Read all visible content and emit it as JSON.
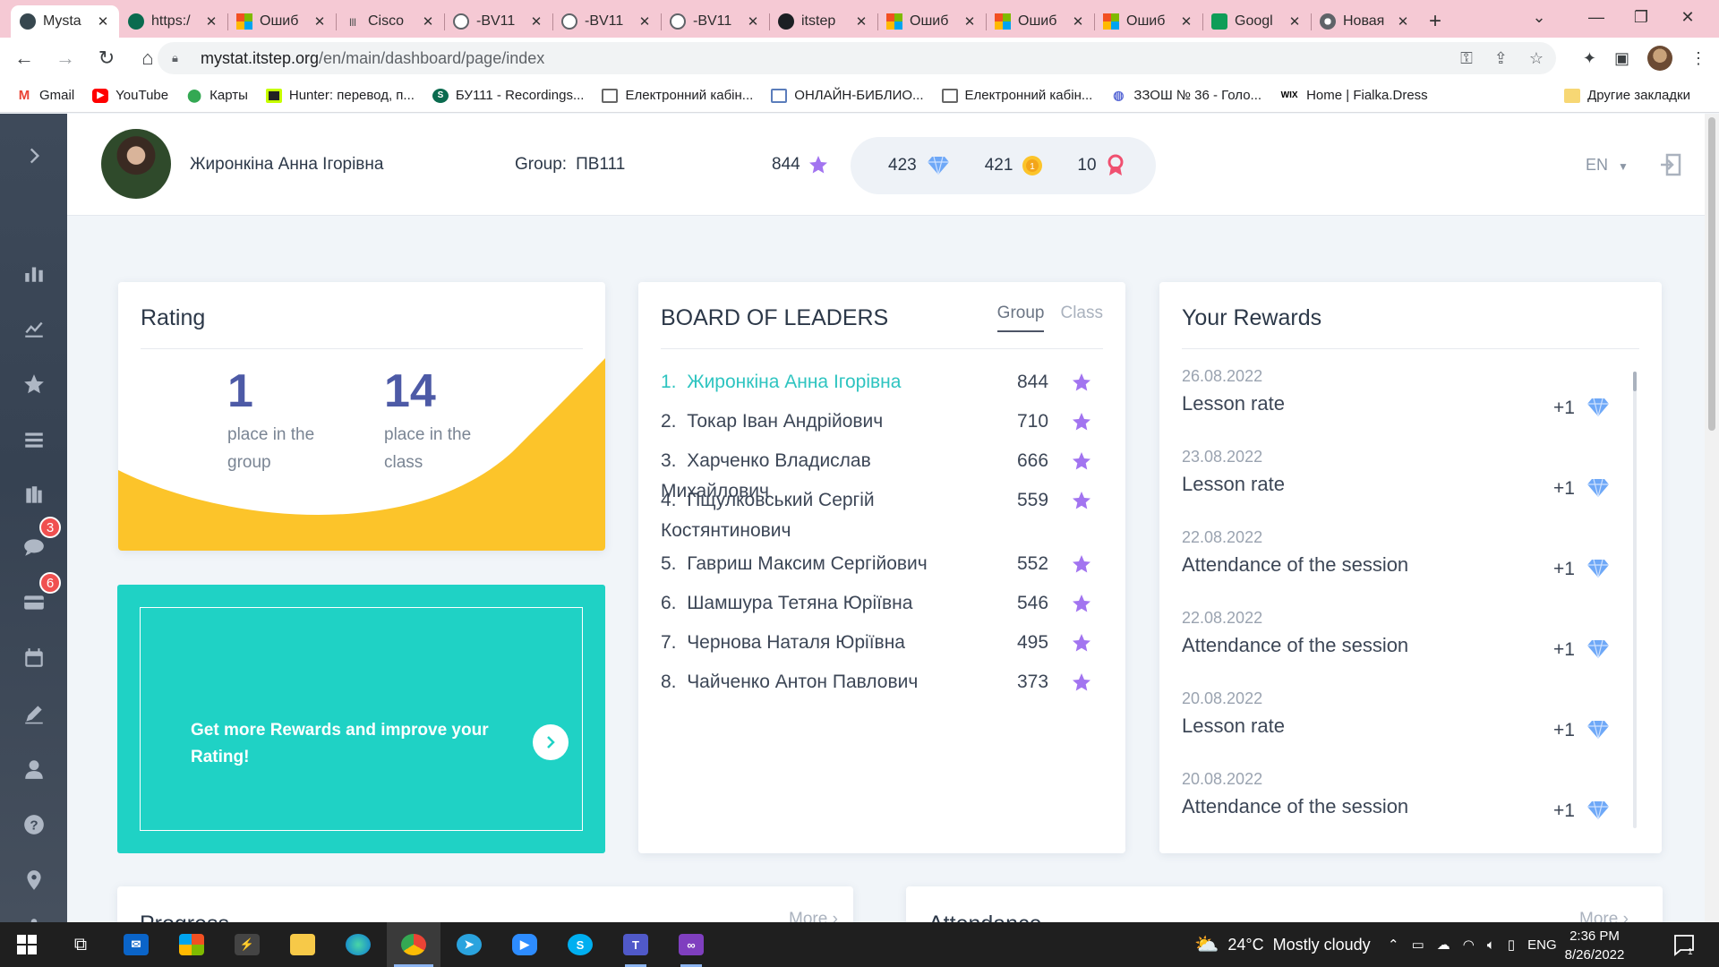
{
  "browser": {
    "tabs": [
      {
        "title": "Mysta",
        "icon": "graduation-cap-icon",
        "active": true
      },
      {
        "title": "https:/",
        "icon": "sharepoint-icon"
      },
      {
        "title": "Ошиб",
        "icon": "microsoft-icon"
      },
      {
        "title": "Cisco",
        "icon": "cisco-icon"
      },
      {
        "title": "-BV11",
        "icon": "globe-icon"
      },
      {
        "title": "-BV11",
        "icon": "globe-icon"
      },
      {
        "title": "-BV11",
        "icon": "globe-icon"
      },
      {
        "title": "itstep",
        "icon": "github-icon"
      },
      {
        "title": "Ошиб",
        "icon": "microsoft-icon"
      },
      {
        "title": "Ошиб",
        "icon": "microsoft-icon"
      },
      {
        "title": "Ошиб",
        "icon": "microsoft-icon"
      },
      {
        "title": "Googl",
        "icon": "google-sheets-icon"
      },
      {
        "title": "Новая",
        "icon": "chrome-icon"
      }
    ],
    "url_host": "mystat.itstep.org",
    "url_path": "/en/main/dashboard/page/index",
    "bookmarks": [
      {
        "label": "Gmail",
        "icon": "gmail-icon"
      },
      {
        "label": "YouTube",
        "icon": "youtube-icon"
      },
      {
        "label": "Карты",
        "icon": "maps-icon"
      },
      {
        "label": "Hunter: перевод, п...",
        "icon": "hunter-icon"
      },
      {
        "label": "БУ111 - Recordings...",
        "icon": "sharepoint-icon"
      },
      {
        "label": "Електронний кабін...",
        "icon": "document-icon"
      },
      {
        "label": "ОНЛАЙН-БИБЛИО...",
        "icon": "library-icon"
      },
      {
        "label": "Електронний кабін...",
        "icon": "document-icon"
      },
      {
        "label": "ЗЗОШ № 36 - Голо...",
        "icon": "school-icon"
      },
      {
        "label": "Home | Fialka.Dress",
        "icon": "wix-icon"
      }
    ],
    "bookmarks_more": "»",
    "other_bookmarks": "Другие закладки"
  },
  "sidebar": {
    "badges": {
      "homework": "3",
      "materials": "6"
    }
  },
  "header": {
    "user_name": "Жиронкіна Анна Ігорівна",
    "group_label": "Group:",
    "group_value": "ПВ111",
    "points": "844",
    "gems": "423",
    "coins": "421",
    "badges": "10",
    "language": "EN"
  },
  "rating": {
    "title": "Rating",
    "group_place": "1",
    "group_place_label": "place in the group",
    "class_place": "14",
    "class_place_label": "place in the class"
  },
  "promo": {
    "text": "Get more Rewards and improve your Rating!"
  },
  "leaders": {
    "title": "BOARD OF LEADERS",
    "tab_group": "Group",
    "tab_class": "Class",
    "rows": [
      {
        "rank": "1.",
        "name": "Жиронкіна Анна Ігорівна",
        "score": "844",
        "me": true
      },
      {
        "rank": "2.",
        "name": "Токар Іван Андрійович",
        "score": "710"
      },
      {
        "rank": "3.",
        "name": "Харченко Владислав Михайлович",
        "score": "666"
      },
      {
        "rank": "4.",
        "name": "Пщулковський Сергій Костянтинович",
        "score": "559"
      },
      {
        "rank": "5.",
        "name": "Гавриш Максим Сергійович",
        "score": "552"
      },
      {
        "rank": "6.",
        "name": "Шамшура Тетяна Юріївна",
        "score": "546"
      },
      {
        "rank": "7.",
        "name": "Чернова Наталя Юріївна",
        "score": "495"
      },
      {
        "rank": "8.",
        "name": "Чайченко Антон Павлович",
        "score": "373"
      }
    ]
  },
  "rewards": {
    "title": "Your Rewards",
    "items": [
      {
        "date": "26.08.2022",
        "title": "Lesson rate",
        "amount": "+1"
      },
      {
        "date": "23.08.2022",
        "title": "Lesson rate",
        "amount": "+1"
      },
      {
        "date": "22.08.2022",
        "title": "Attendance of the session",
        "amount": "+1"
      },
      {
        "date": "22.08.2022",
        "title": "Attendance of the session",
        "amount": "+1"
      },
      {
        "date": "20.08.2022",
        "title": "Lesson rate",
        "amount": "+1"
      },
      {
        "date": "20.08.2022",
        "title": "Attendance of the session",
        "amount": "+1"
      }
    ]
  },
  "bottom": {
    "progress_title": "Progress",
    "attendance_title": "Attendance",
    "more_label": "More"
  },
  "taskbar": {
    "temperature": "24°C",
    "weather": "Mostly cloudy",
    "lang": "ENG",
    "time": "2:36 PM",
    "date": "8/26/2022",
    "notifications": "1"
  },
  "colors": {
    "accent_teal": "#1fd2c5",
    "rating_yellow": "#fcc42a",
    "star_purple": "#a274f0",
    "gem_blue": "#6ea8f7",
    "leader_highlight": "#2ec4c0"
  }
}
